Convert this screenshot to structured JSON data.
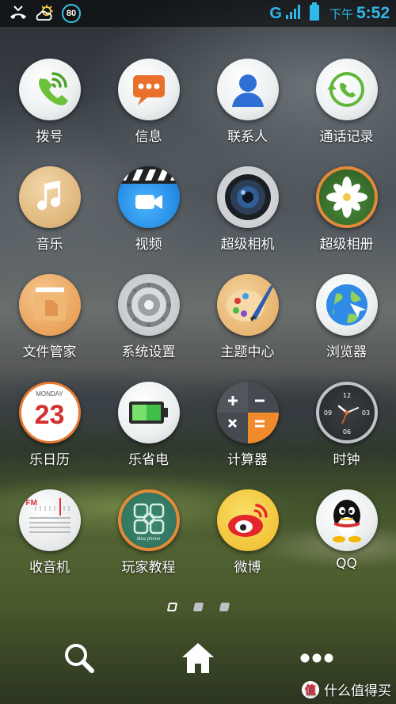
{
  "status_bar": {
    "battery_badge": "80",
    "network": "G",
    "time_period": "下午",
    "time": "5:52",
    "accent_color": "#2fb8e8"
  },
  "apps": [
    {
      "label": "拨号",
      "icon": "phone-dial-icon"
    },
    {
      "label": "信息",
      "icon": "message-icon"
    },
    {
      "label": "联系人",
      "icon": "contacts-icon"
    },
    {
      "label": "通话记录",
      "icon": "call-log-icon"
    },
    {
      "label": "音乐",
      "icon": "music-icon"
    },
    {
      "label": "视频",
      "icon": "video-icon"
    },
    {
      "label": "超级相机",
      "icon": "camera-icon"
    },
    {
      "label": "超级相册",
      "icon": "gallery-icon"
    },
    {
      "label": "文件管家",
      "icon": "file-manager-icon"
    },
    {
      "label": "系统设置",
      "icon": "settings-icon"
    },
    {
      "label": "主题中心",
      "icon": "theme-palette-icon"
    },
    {
      "label": "浏览器",
      "icon": "browser-globe-icon"
    },
    {
      "label": "乐日历",
      "icon": "calendar-icon",
      "calendar_day": "MONDAY",
      "calendar_date": "23"
    },
    {
      "label": "乐省电",
      "icon": "battery-saver-icon"
    },
    {
      "label": "计算器",
      "icon": "calculator-icon"
    },
    {
      "label": "时钟",
      "icon": "clock-icon"
    },
    {
      "label": "收音机",
      "icon": "radio-icon",
      "radio_badge": "FM"
    },
    {
      "label": "玩家教程",
      "icon": "tutorial-icon",
      "tutorial_caption": "idea phone"
    },
    {
      "label": "微博",
      "icon": "weibo-icon"
    },
    {
      "label": "QQ",
      "icon": "qq-penguin-icon"
    }
  ],
  "pager": {
    "pages": 3,
    "active": 1
  },
  "dock": {
    "search": "search-icon",
    "home": "home-icon",
    "more": "more-icon"
  },
  "watermark": {
    "text": "什么值得买",
    "logo_char": "值"
  }
}
